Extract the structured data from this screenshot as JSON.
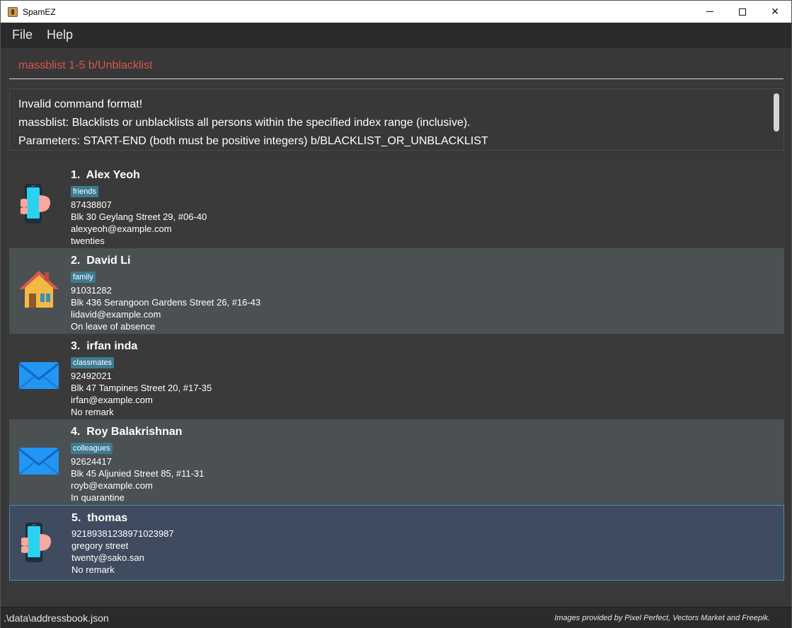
{
  "window": {
    "title": "SpamEZ",
    "minimize_icon": "minimize-icon",
    "maximize_icon": "maximize-icon",
    "close_glyph": "✕"
  },
  "menu": {
    "file": "File",
    "help": "Help"
  },
  "command": {
    "value": "massblist 1-5 b/Unblacklist",
    "color": "#d9544d"
  },
  "result": {
    "lines": [
      "Invalid command format!",
      "massblist: Blacklists or unblacklists all persons within the specified index range (inclusive).",
      "Parameters: START-END (both must be positive integers) b/BLACKLIST_OR_UNBLACKLIST"
    ]
  },
  "persons": [
    {
      "index": "1.",
      "name": "Alex Yeoh",
      "tag": "friends",
      "phone": "87438807",
      "address": "Blk 30 Geylang Street 29, #06-40",
      "email": "alexyeoh@example.com",
      "remark": "twenties",
      "icon": "phone-icon"
    },
    {
      "index": "2.",
      "name": "David Li",
      "tag": "family",
      "phone": "91031282",
      "address": "Blk 436 Serangoon Gardens Street 26, #16-43",
      "email": "lidavid@example.com",
      "remark": "On leave of absence",
      "icon": "house-icon"
    },
    {
      "index": "3.",
      "name": "irfan inda",
      "tag": "classmates",
      "phone": "92492021",
      "address": "Blk 47 Tampines Street 20, #17-35",
      "email": "irfan@example.com",
      "remark": "No remark",
      "icon": "envelope-icon"
    },
    {
      "index": "4.",
      "name": "Roy Balakrishnan",
      "tag": "colleagues",
      "phone": "92624417",
      "address": "Blk 45 Aljunied Street 85, #11-31",
      "email": "royb@example.com",
      "remark": "In quarantine",
      "icon": "envelope-icon"
    },
    {
      "index": "5.",
      "name": "thomas",
      "tag": "",
      "phone": "92189381238971023987",
      "address": "gregory street",
      "email": "twenty@sako.san",
      "remark": "No remark",
      "icon": "phone-icon"
    }
  ],
  "status": {
    "file_path": ".\\data\\addressbook.json",
    "credits": "Images provided by Pixel Perfect, Vectors Market and Freepik."
  },
  "colors": {
    "tag": "#3e7b91",
    "selected_border": "#3c8fbd",
    "card_dark": "#3a3a3a",
    "card_light": "#4b5052",
    "card_selected": "#3f4b5e"
  }
}
